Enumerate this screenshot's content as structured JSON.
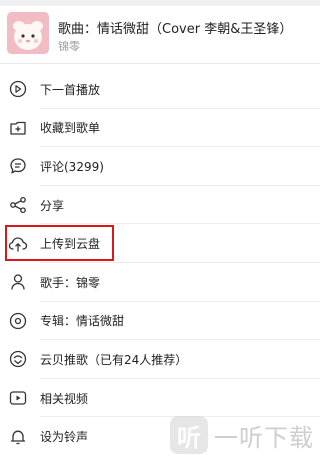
{
  "song": {
    "title": "歌曲：情话微甜（Cover 李朝&王圣锋）",
    "artist": "锦零"
  },
  "menu": [
    {
      "label": "下一首播放",
      "icon": "play-next-icon"
    },
    {
      "label": "收藏到歌单",
      "icon": "add-to-playlist-icon"
    },
    {
      "label": "评论(3299)",
      "icon": "comment-icon"
    },
    {
      "label": "分享",
      "icon": "share-icon"
    },
    {
      "label": "上传到云盘",
      "icon": "cloud-upload-icon"
    },
    {
      "label": "歌手：锦零",
      "icon": "singer-icon"
    },
    {
      "label": "专辑：情话微甜",
      "icon": "album-icon"
    },
    {
      "label": "云贝推歌（已有24人推荐）",
      "icon": "recommend-icon"
    },
    {
      "label": "相关视频",
      "icon": "video-icon"
    },
    {
      "label": "设为铃声",
      "icon": "bell-icon"
    }
  ],
  "watermark": {
    "logo_char": "听",
    "text": "一听下载"
  },
  "colors": {
    "highlight": "#d9181c",
    "icon_stroke": "#333333",
    "secondary_text": "#9a9a9a"
  }
}
